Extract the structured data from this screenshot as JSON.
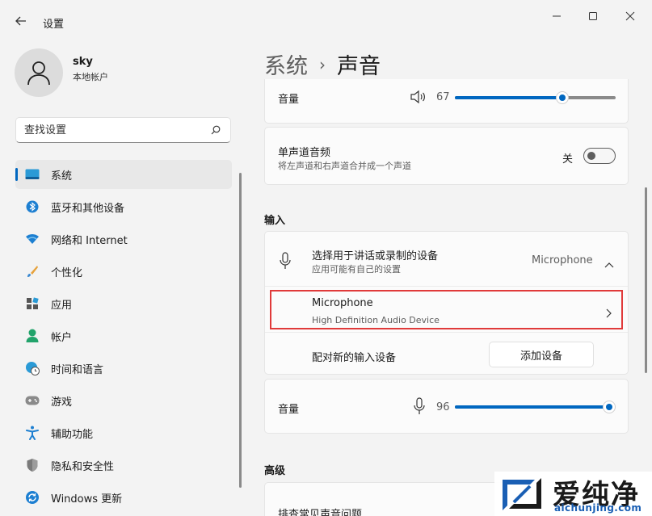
{
  "window": {
    "app_title": "设置"
  },
  "user": {
    "name": "sky",
    "account_type": "本地帐户"
  },
  "search": {
    "placeholder": "查找设置"
  },
  "sidebar": {
    "items": [
      {
        "label": "系统",
        "icon": "system-icon",
        "active": true
      },
      {
        "label": "蓝牙和其他设备",
        "icon": "bluetooth-icon"
      },
      {
        "label": "网络和 Internet",
        "icon": "wifi-icon"
      },
      {
        "label": "个性化",
        "icon": "brush-icon"
      },
      {
        "label": "应用",
        "icon": "apps-icon"
      },
      {
        "label": "帐户",
        "icon": "account-icon"
      },
      {
        "label": "时间和语言",
        "icon": "clock-globe-icon"
      },
      {
        "label": "游戏",
        "icon": "gamepad-icon"
      },
      {
        "label": "辅助功能",
        "icon": "accessibility-icon"
      },
      {
        "label": "隐私和安全性",
        "icon": "shield-icon"
      },
      {
        "label": "Windows 更新",
        "icon": "update-icon"
      }
    ]
  },
  "breadcrumb": {
    "parent": "系统",
    "separator": "›",
    "current": "声音"
  },
  "output_volume": {
    "label": "音量",
    "value": "67",
    "level": 67
  },
  "mono_audio": {
    "title": "单声道音频",
    "subtitle": "将左声道和右声道合并成一个声道",
    "state_label": "关"
  },
  "input_section": {
    "title": "输入",
    "device_select": {
      "title": "选择用于讲话或录制的设备",
      "subtitle": "应用可能有自己的设置",
      "selected": "Microphone"
    },
    "device": {
      "name": "Microphone",
      "description": "High Definition Audio Device"
    },
    "pair": {
      "label": "配对新的输入设备",
      "button": "添加设备"
    },
    "volume": {
      "label": "音量",
      "value": "96",
      "level": 96
    }
  },
  "advanced_section": {
    "title": "高级",
    "troubleshoot": "排查常见声音问题"
  },
  "watermark": {
    "brand": "爱纯净",
    "url": "aichunjing.com"
  },
  "colors": {
    "accent": "#0067c0",
    "highlight": "#e03a3a"
  }
}
